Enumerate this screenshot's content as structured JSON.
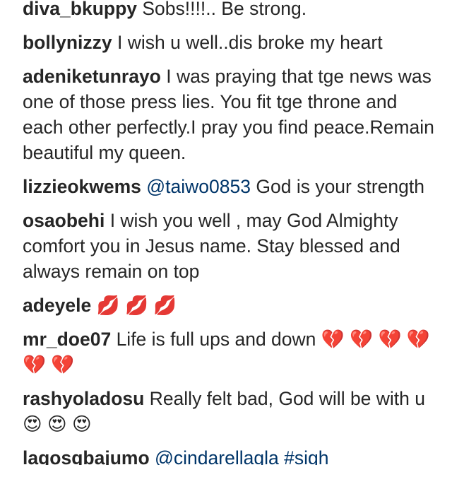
{
  "comments": [
    {
      "username": "diva_bkuppy",
      "text": " Sobs!!!!.. Be strong."
    },
    {
      "username": "bollynizzy",
      "text": " I wish u well..dis broke my heart"
    },
    {
      "username": "adeniketunrayo",
      "text": " I was praying that tge news was one of those press lies. You fit tge throne and each other perfectly.I pray you find peace.Remain beautiful my queen."
    },
    {
      "username": "lizzieokwems",
      "mention": "@taiwo0853",
      "text": " God is your strength"
    },
    {
      "username": "osaobehi",
      "text": " I wish you well , may God Almighty comfort you in Jesus name. Stay blessed and always remain on top"
    },
    {
      "username": "adeyele",
      "text": " 💋 💋 💋"
    },
    {
      "username": "mr_doe07",
      "text": " Life is full ups and down 💔 💔 💔 💔 💔 💔"
    },
    {
      "username": "rashyoladosu",
      "text": " Really felt bad, God will be with u 😍 😍 😍"
    },
    {
      "username": "lagosgbajumo",
      "mention": "@cindarellagla",
      "mention2": "#sigh"
    }
  ]
}
